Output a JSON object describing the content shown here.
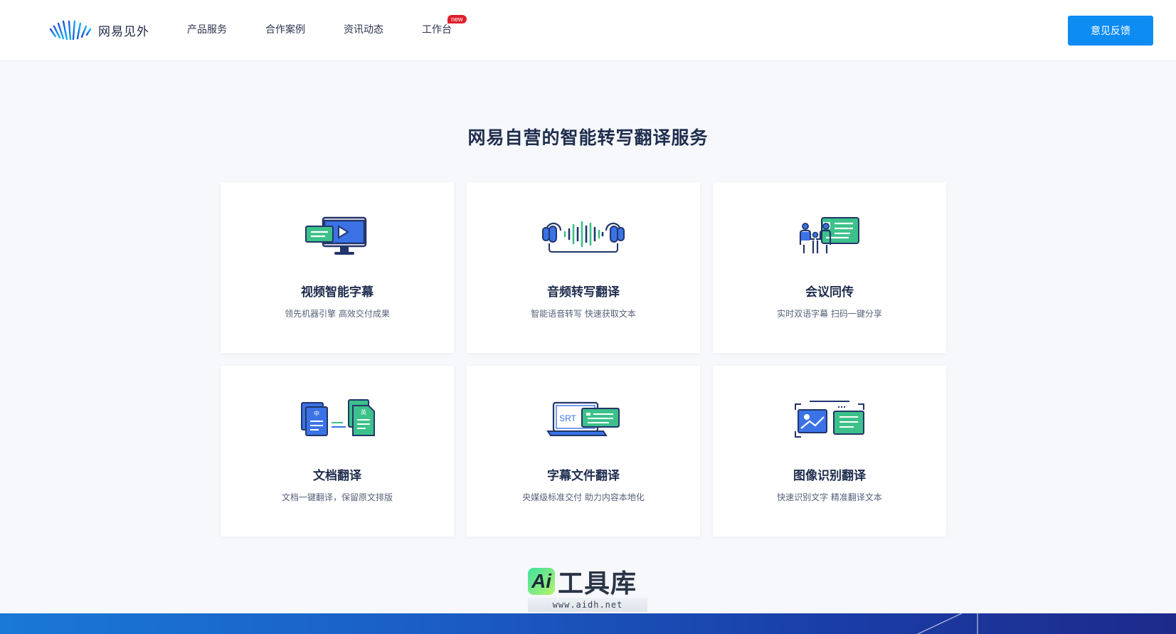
{
  "header": {
    "logo_text": "网易见外",
    "nav": [
      {
        "label": "产品服务"
      },
      {
        "label": "合作案例"
      },
      {
        "label": "资讯动态"
      },
      {
        "label": "工作台",
        "badge": "new"
      }
    ],
    "feedback_label": "意见反馈"
  },
  "main": {
    "title": "网易自营的智能转写翻译服务",
    "cards": [
      {
        "title": "视频智能字幕",
        "subtitle": "领先机器引擎 高效交付成果",
        "icon": "video-subtitle-icon"
      },
      {
        "title": "音频转写翻译",
        "subtitle": "智能语音转写 快速获取文本",
        "icon": "audio-transcribe-icon"
      },
      {
        "title": "会议同传",
        "subtitle": "实时双语字幕 扫码一键分享",
        "icon": "meeting-interpret-icon"
      },
      {
        "title": "文档翻译",
        "subtitle": "文档一键翻译，保留原文排版",
        "icon": "document-translate-icon",
        "icon_labels": [
          "中",
          "英"
        ]
      },
      {
        "title": "字幕文件翻译",
        "subtitle": "央媒级标准交付 助力内容本地化",
        "icon": "subtitle-file-icon",
        "icon_label": "SRT"
      },
      {
        "title": "图像识别翻译",
        "subtitle": "快速识别文字 精准翻译文本",
        "icon": "image-recognition-icon"
      }
    ]
  },
  "watermark": {
    "badge": "Ai",
    "name": "工具库",
    "url": "www.aidh.net"
  },
  "colors": {
    "accent": "#0d8cf2",
    "icon_blue": "#3b73e6",
    "icon_green": "#3cc18a",
    "title": "#1f2d4e"
  }
}
